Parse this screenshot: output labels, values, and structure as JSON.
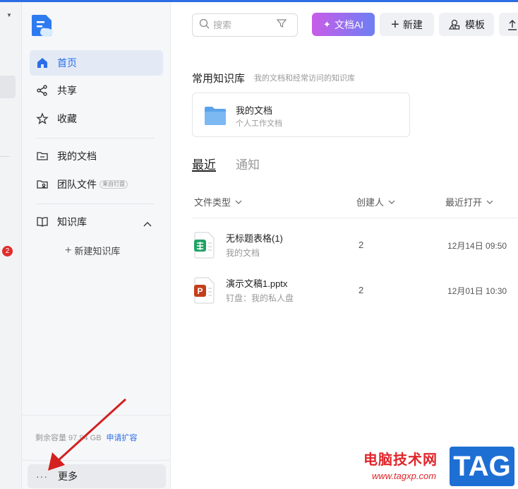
{
  "sidebar": {
    "nav": [
      {
        "label": "首页",
        "icon": "home-icon",
        "active": true
      },
      {
        "label": "共享",
        "icon": "share-icon"
      },
      {
        "label": "收藏",
        "icon": "star-icon"
      },
      {
        "label": "我的文档",
        "icon": "folder-icon"
      },
      {
        "label": "团队文件",
        "icon": "team-folder-icon",
        "tag": "来自钉盘"
      },
      {
        "label": "知识库",
        "icon": "book-icon"
      }
    ],
    "new_kb_label": "新建知识库",
    "storage_text": "剩余容量 97.94 GB",
    "expand_label": "申请扩容",
    "more_label": "更多",
    "left_strip_badge": "2"
  },
  "toolbar": {
    "search_placeholder": "搜索",
    "ai_label": "文档AI",
    "new_label": "新建",
    "template_label": "模板"
  },
  "knowledge": {
    "title": "常用知识库",
    "subtitle": "我的文档和经常访问的知识库",
    "card_name": "我的文档",
    "card_desc": "个人工作文档"
  },
  "tabs": {
    "recent": "最近",
    "notice": "通知"
  },
  "columns": {
    "type": "文件类型",
    "creator": "创建人",
    "opened": "最近打开"
  },
  "files": [
    {
      "name": "无标题表格(1)",
      "location": "我的文档",
      "creator": "2",
      "opened": "12月14日 09:50",
      "kind": "spreadsheet-icon"
    },
    {
      "name": "演示文稿1.pptx",
      "location": "钉盘：我的私人盘",
      "creator": "2",
      "opened": "12月01日 10:30",
      "kind": "presentation-icon"
    }
  ],
  "watermark": {
    "site": "电脑技术网",
    "url": "www.tagxp.com",
    "logo": "TAG"
  },
  "colors": {
    "accent": "#2b6de5",
    "badge": "#e02d2d",
    "arrow": "#d42020"
  }
}
